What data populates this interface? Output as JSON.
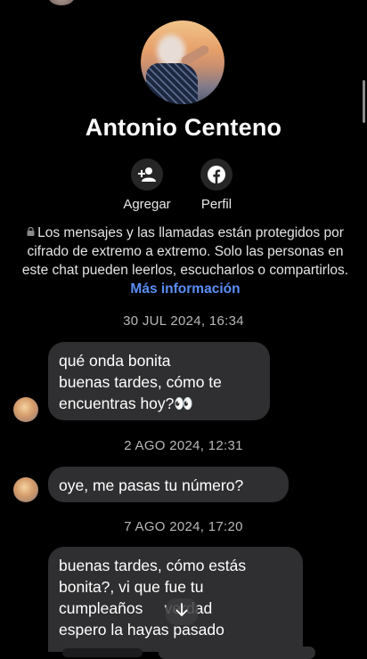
{
  "profile": {
    "name": "Antonio Centeno"
  },
  "actions": [
    {
      "label": "Agregar",
      "icon": "add-person-icon"
    },
    {
      "label": "Perfil",
      "icon": "facebook-icon"
    }
  ],
  "encryption": {
    "text": "Los mensajes y las llamadas están protegidos por cifrado de extremo a extremo. Solo las personas en este chat pueden leerlos, escucharlos o compartirlos.",
    "link": "Más información"
  },
  "messages": [
    {
      "timestamp": "30 JUL 2024, 16:34",
      "lines": [
        "qué onda bonita",
        "buenas tardes, cómo te",
        "encuentras hoy?👀"
      ]
    },
    {
      "timestamp": "2 AGO 2024, 12:31",
      "lines": [
        "oye, me pasas tu número?"
      ]
    },
    {
      "timestamp": "7 AGO 2024, 17:20",
      "lines": [
        "buenas tardes, cómo estás",
        "bonita?, vi que fue tu",
        "cumpleaños     verdad",
        "espero la hayas pasado"
      ]
    }
  ],
  "scroll_down_icon": "arrow-down-icon",
  "colors": {
    "background": "#000000",
    "bubble": "#2f2f31",
    "link": "#5b8ef7",
    "timestamp": "#b8b8b8"
  }
}
